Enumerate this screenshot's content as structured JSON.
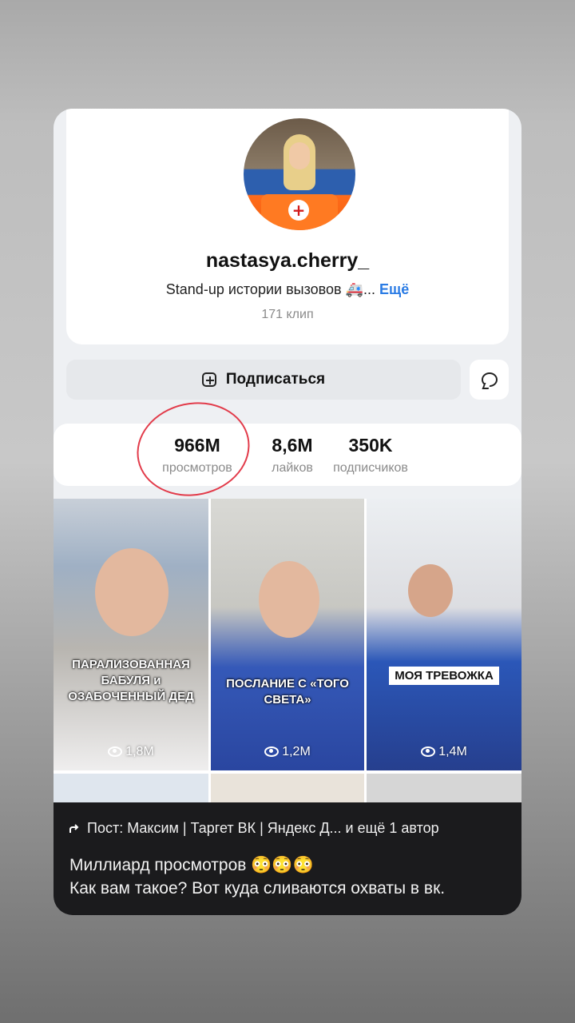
{
  "profile": {
    "username": "nastasya.cherry_",
    "bio": "Stand-up истории вызовов 🚑...",
    "bio_more": "Ещё",
    "clips": "171 клип"
  },
  "actions": {
    "subscribe_label": "Подписаться"
  },
  "stats": [
    {
      "value": "966M",
      "label": "просмотров"
    },
    {
      "value": "8,6M",
      "label": "лайков"
    },
    {
      "value": "350K",
      "label": "подписчиков"
    }
  ],
  "clips_grid": [
    {
      "caption": "ПАРАЛИЗОВАННАЯ БАБУЛЯ и ОЗАБОЧЕННЫЙ ДЕД",
      "views": "1,8M"
    },
    {
      "caption": "ПОСЛАНИЕ С «ТОГО СВЕТА»",
      "views": "1,2M"
    },
    {
      "caption": "МОЯ ТРЕВОЖКА",
      "views": "1,4M"
    }
  ],
  "post": {
    "repost_line": "Пост: Максим | Таргет ВК | Яндекс Д... и ещё 1 автор",
    "line1": "Миллиард просмотров 😳😳😳",
    "line2": "Как вам такое? Вот куда сливаются охваты в вк."
  },
  "colors": {
    "annotation_circle": "#e23b4a",
    "link": "#2a7be4"
  }
}
